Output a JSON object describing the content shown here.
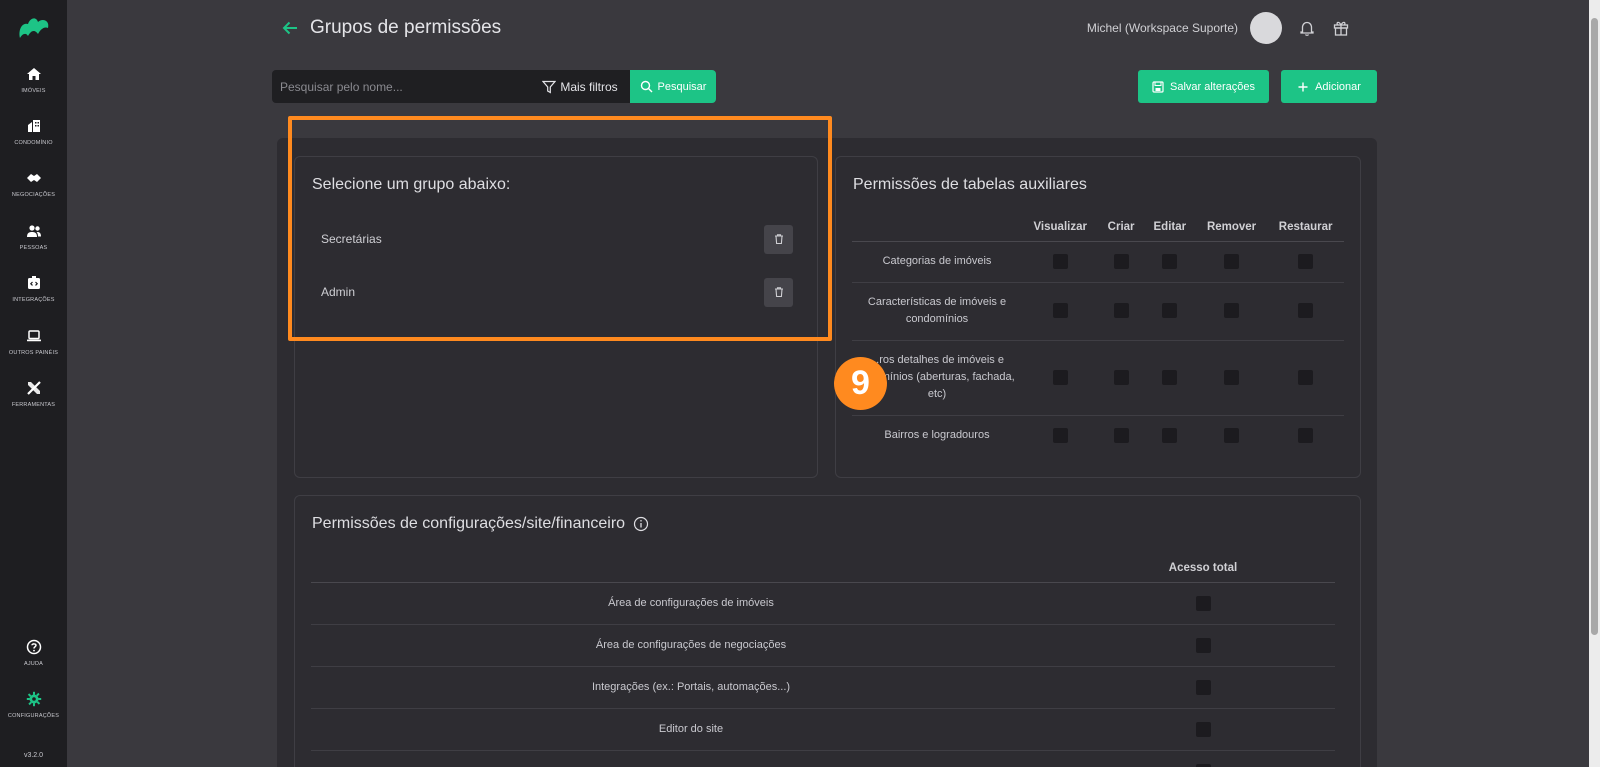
{
  "sidebar": {
    "items": [
      {
        "label": "Imóveis",
        "icon": "home-icon"
      },
      {
        "label": "Condomínio",
        "icon": "building-icon"
      },
      {
        "label": "Negociações",
        "icon": "handshake-icon"
      },
      {
        "label": "Pessoas",
        "icon": "people-icon"
      },
      {
        "label": "Integrações",
        "icon": "integration-icon"
      },
      {
        "label": "Outros painéis",
        "icon": "laptop-icon"
      },
      {
        "label": "Ferramentas",
        "icon": "tools-icon"
      }
    ],
    "bottom_items": [
      {
        "label": "Ajuda",
        "icon": "help-icon"
      },
      {
        "label": "Configurações",
        "icon": "gear-icon"
      }
    ],
    "version": "v3.2.0",
    "accent": "#1dc486"
  },
  "header": {
    "title": "Grupos de permissões",
    "user_name": "Michel (Workspace Suporte)"
  },
  "toolbar": {
    "search_placeholder": "Pesquisar pelo nome...",
    "more_filters_label": "Mais filtros",
    "search_label": "Pesquisar",
    "save_label": "Salvar alterações",
    "add_label": "Adicionar"
  },
  "groups": {
    "title": "Selecione um grupo abaixo:",
    "items": [
      "Secretárias",
      "Admin"
    ]
  },
  "aux_permissions": {
    "title": "Permissões de tabelas auxiliares",
    "columns": [
      "Visualizar",
      "Criar",
      "Editar",
      "Remover",
      "Restaurar"
    ],
    "rows": [
      "Categorias de imóveis",
      "Características de imóveis e condomínios",
      "...ros detalhes de imóveis e ...domínios (aberturas, fachada, etc)",
      "Bairros e logradouros"
    ]
  },
  "config_permissions": {
    "title": "Permissões de configurações/site/financeiro",
    "column": "Acesso total",
    "rows": [
      "Área de configurações de imóveis",
      "Área de configurações de negociações",
      "Integrações (ex.: Portais, automações...)",
      "Editor do site"
    ]
  },
  "annotation": {
    "step_number": "9",
    "color": "#ff8a1f"
  }
}
